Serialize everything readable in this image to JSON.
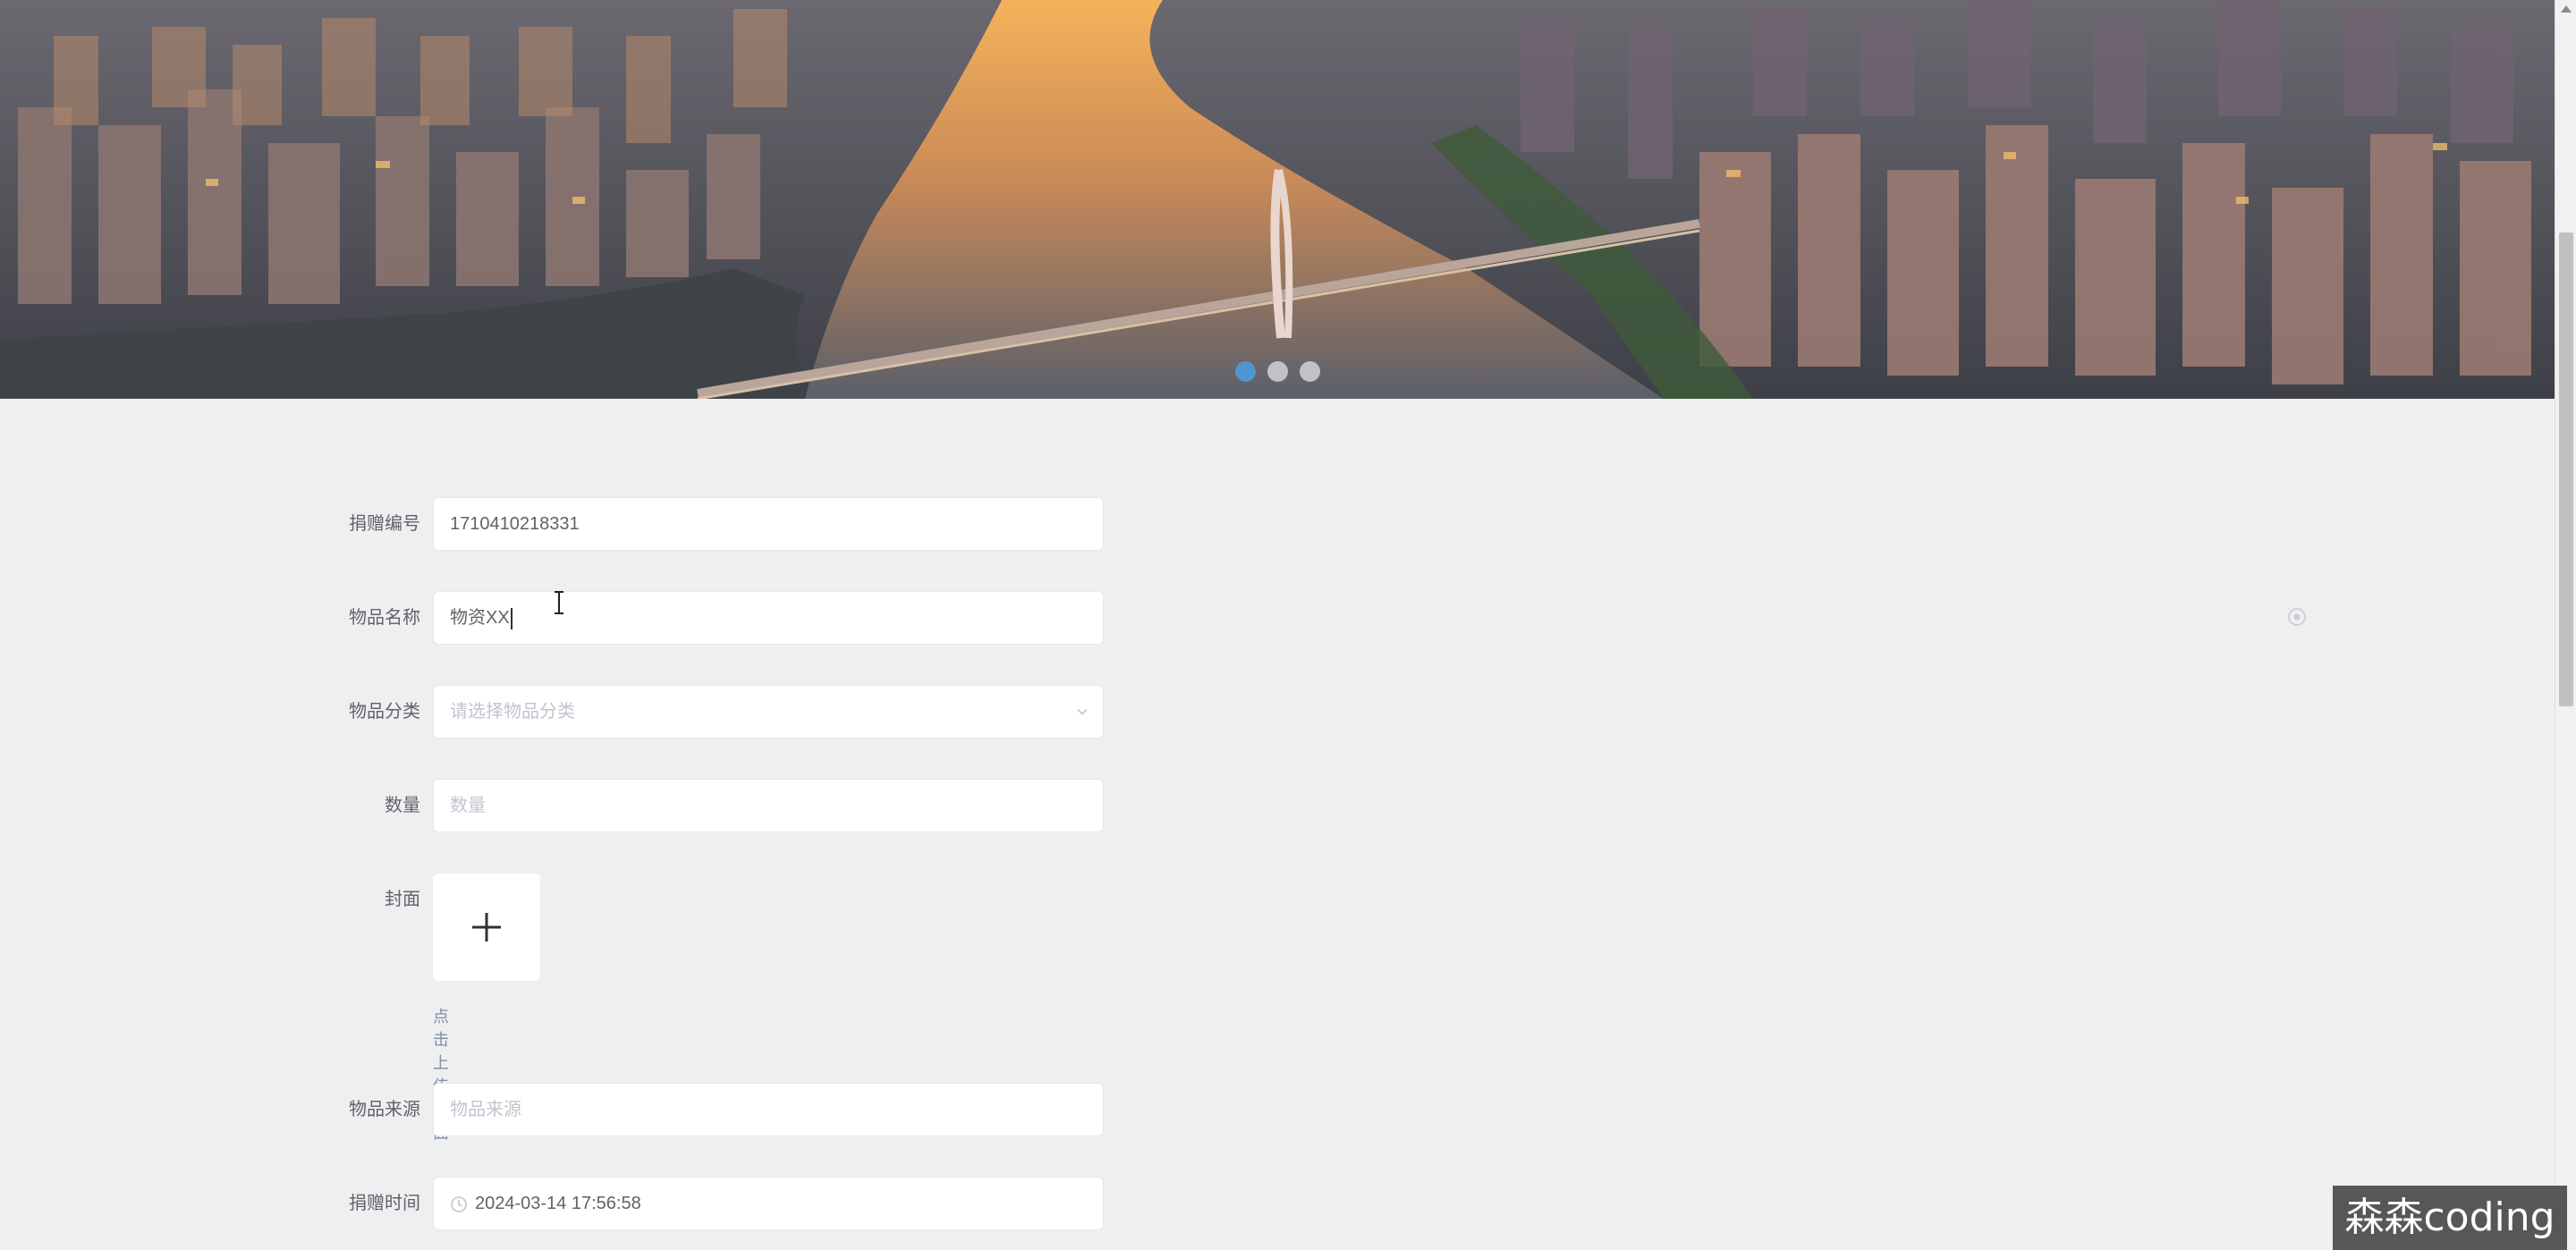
{
  "banner": {
    "slides": 3,
    "active_slide": 1
  },
  "form": {
    "donation_no": {
      "label": "捐赠编号",
      "value": "1710410218331"
    },
    "item_name": {
      "label": "物品名称",
      "value": "物资XX"
    },
    "category": {
      "label": "物品分类",
      "placeholder": "请选择物品分类"
    },
    "quantity": {
      "label": "数量",
      "placeholder": "数量"
    },
    "cover": {
      "label": "封面",
      "tip": "点击上传封面"
    },
    "source": {
      "label": "物品来源",
      "placeholder": "物品来源"
    },
    "donation_time": {
      "label": "捐赠时间",
      "value": "2024-03-14 17:56:58"
    }
  },
  "watermark": {
    "text": "森森coding"
  },
  "colors": {
    "page_bg": "#eeeff1",
    "active_dot": "#4c9bdb",
    "inactive_dot": "#c9ccd1"
  }
}
